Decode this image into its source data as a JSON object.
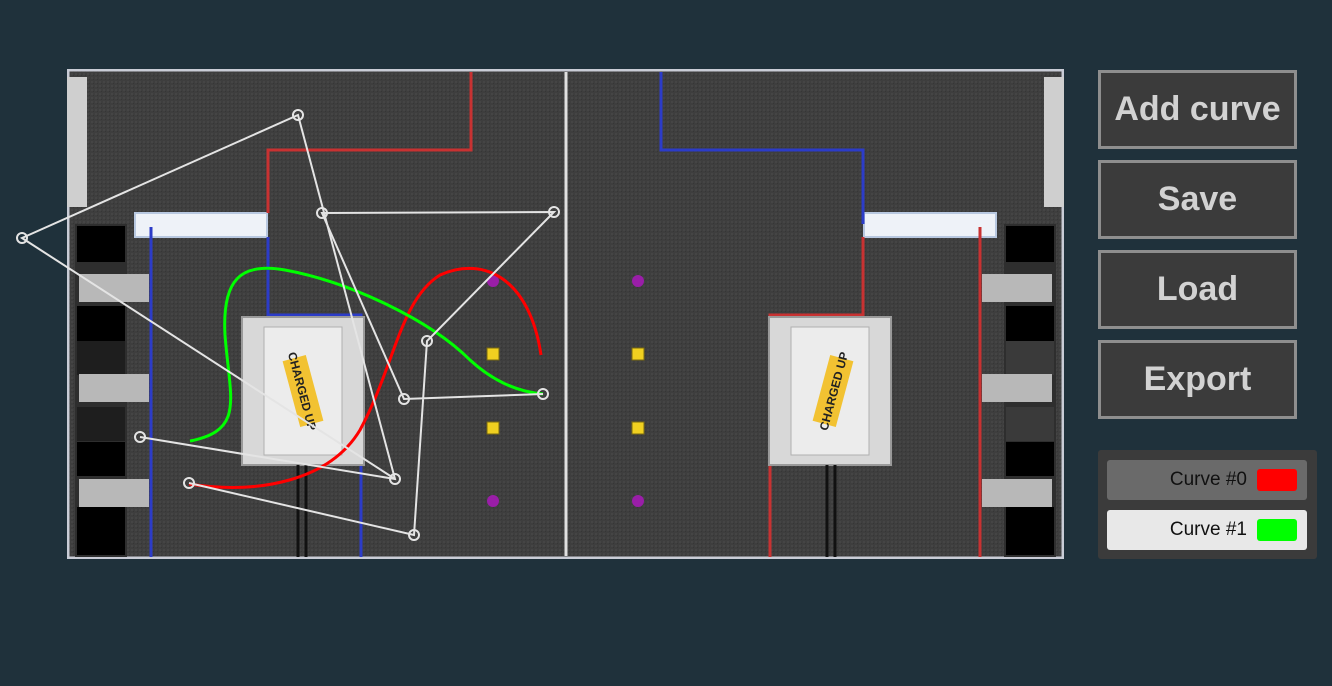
{
  "toolbar": {
    "add_curve_label": "Add curve",
    "save_label": "Save",
    "load_label": "Load",
    "export_label": "Export"
  },
  "curves": [
    {
      "label": "Curve #0",
      "color": "#ff0000",
      "selected": false
    },
    {
      "label": "Curve #1",
      "color": "#00ff00",
      "selected": true
    }
  ],
  "field": {
    "blue_alliance_color": "#0b0b8a",
    "red_alliance_color": "#c00d0d",
    "charge_station_text": "CHARGED UP",
    "cone_color": "#f0d020",
    "cube_color": "#9a1ea8"
  }
}
